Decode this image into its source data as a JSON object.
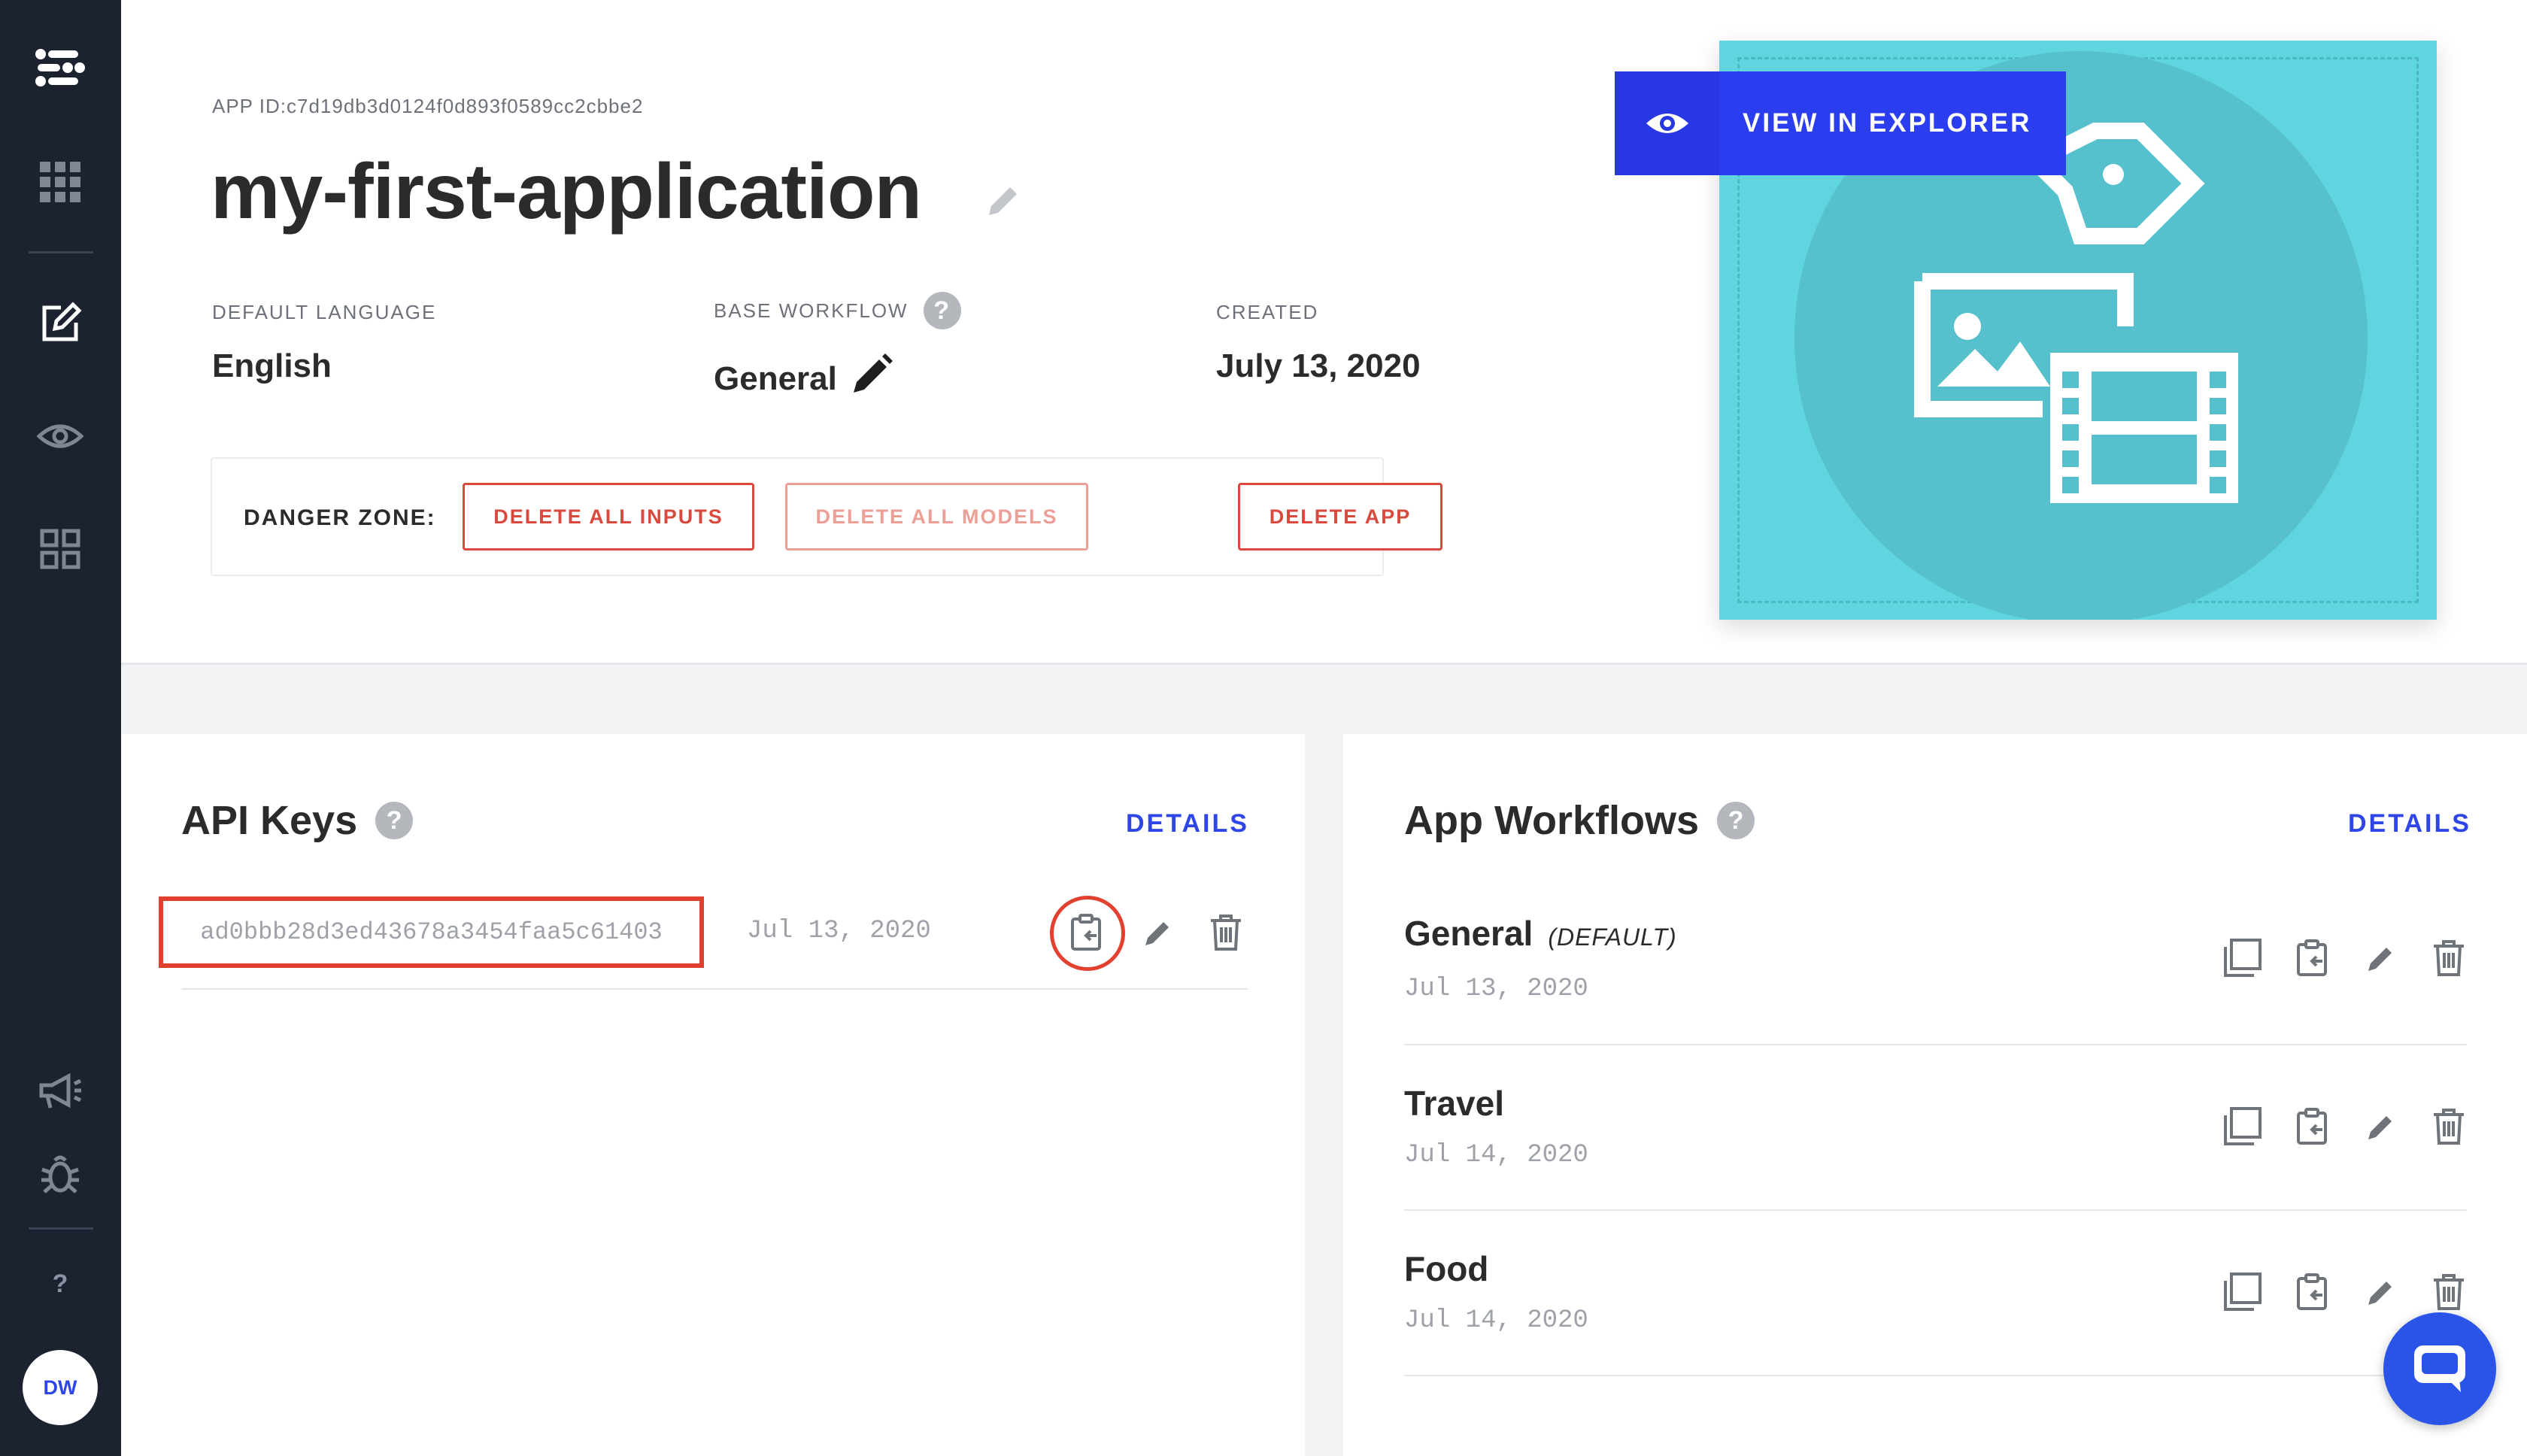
{
  "sidebar": {
    "items": [
      {
        "icon": "logo-icon"
      },
      {
        "icon": "apps-grid-icon"
      },
      {
        "icon": "edit-icon"
      },
      {
        "icon": "eye-icon"
      },
      {
        "icon": "dashboard-icon"
      },
      {
        "icon": "megaphone-icon"
      },
      {
        "icon": "bug-icon"
      }
    ],
    "help_label": "?",
    "avatar_initials": "DW"
  },
  "header": {
    "app_id": "APP ID:c7d19db3d0124f0d893f0589cc2cbbe2",
    "title": "my-first-application",
    "default_language_label": "DEFAULT LANGUAGE",
    "default_language_value": "English",
    "base_workflow_label": "BASE WORKFLOW",
    "base_workflow_value": "General",
    "created_label": "CREATED",
    "created_value": "July 13, 2020",
    "help_badge": "?"
  },
  "danger_zone": {
    "label": "DANGER ZONE:",
    "delete_inputs": "DELETE ALL INPUTS",
    "delete_models": "DELETE ALL MODELS",
    "delete_app": "DELETE APP"
  },
  "explorer": {
    "label": "VIEW IN EXPLORER"
  },
  "api_keys": {
    "title": "API Keys",
    "details": "DETAILS",
    "keys": [
      {
        "key": "ad0bbb28d3ed43678a3454faa5c61403",
        "date": "Jul 13, 2020"
      }
    ]
  },
  "workflows": {
    "title": "App Workflows",
    "details": "DETAILS",
    "default_tag": "(DEFAULT)",
    "items": [
      {
        "name": "General",
        "date": "Jul 13, 2020"
      },
      {
        "name": "Travel",
        "date": "Jul 14, 2020"
      },
      {
        "name": "Food",
        "date": "Jul 14, 2020"
      }
    ]
  },
  "colors": {
    "sidebar": "#1c2230",
    "accent": "#2f46e6",
    "danger": "#d9493d",
    "thumbnail": "#5fd5e0"
  }
}
